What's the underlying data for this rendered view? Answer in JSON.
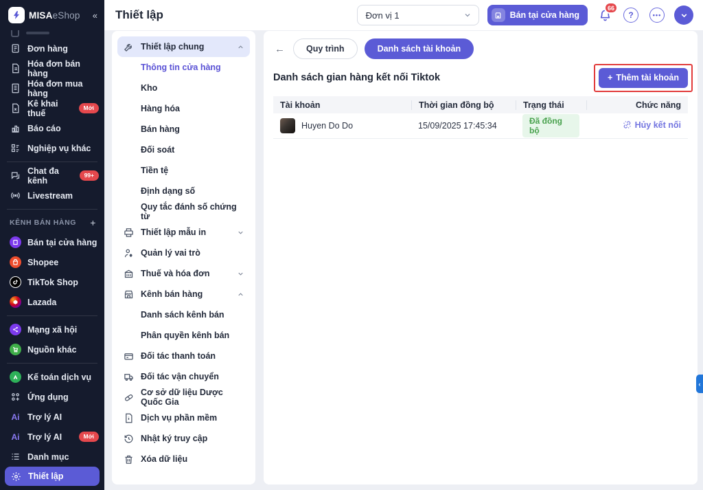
{
  "colors": {
    "accent": "#5b5bd6",
    "sidebar_bg": "#151b2d",
    "annotation_red": "#e23b3b",
    "badge_red": "#e5484d",
    "status_green_bg": "#e7f6ea",
    "status_green_text": "#48a14d",
    "selected_item_bg": "#e3e8fb",
    "edge_tab_blue": "#2176d9"
  },
  "brand": {
    "misa": "MISA",
    "eshop": "eShop"
  },
  "icons": {
    "collapse": "«",
    "back": "←",
    "plus": "+",
    "help": "?",
    "more": "•••",
    "edge_collapse": "‹",
    "ai": "Ai",
    "section_add": "+"
  },
  "topbar": {
    "title": "Thiết lập",
    "unit_select": {
      "value": "Đơn vị 1"
    },
    "store_button": "Bán tại cửa hàng",
    "notification_count": "66"
  },
  "primary_sidebar": {
    "section_label": "KÊNH BÁN HÀNG",
    "items": [
      {
        "label": "Đơn hàng"
      },
      {
        "label": "Hóa đơn bán hàng"
      },
      {
        "label": "Hóa đơn mua hàng"
      },
      {
        "label": "Kê khai thuế",
        "badge": "Mới"
      },
      {
        "label": "Báo cáo"
      },
      {
        "label": "Nghiệp vụ khác"
      },
      {
        "label": "Chat đa kênh",
        "badge": "99+"
      },
      {
        "label": "Livestream"
      },
      {
        "label": "Bán tại cửa hàng"
      },
      {
        "label": "Shopee"
      },
      {
        "label": "TikTok Shop"
      },
      {
        "label": "Lazada"
      },
      {
        "label": "Mạng xã hội"
      },
      {
        "label": "Nguồn khác"
      },
      {
        "label": "Kế toán dịch vụ"
      },
      {
        "label": "Ứng dụng"
      },
      {
        "label": "Trợ lý AI"
      },
      {
        "label": "Trợ lý AI",
        "badge": "Mới"
      },
      {
        "label": "Danh mục"
      },
      {
        "label": "Thiết lập"
      }
    ]
  },
  "settings_sidebar": {
    "items": [
      {
        "label": "Thiết lập chung"
      },
      {
        "label": "Thông tin cửa hàng"
      },
      {
        "label": "Kho"
      },
      {
        "label": "Hàng hóa"
      },
      {
        "label": "Bán hàng"
      },
      {
        "label": "Đối soát"
      },
      {
        "label": "Tiền tệ"
      },
      {
        "label": "Định dạng số"
      },
      {
        "label": "Quy tắc đánh số chứng từ"
      },
      {
        "label": "Thiết lập mẫu in"
      },
      {
        "label": "Quản lý vai trò"
      },
      {
        "label": "Thuế và hóa đơn"
      },
      {
        "label": "Kênh bán hàng"
      },
      {
        "label": "Danh sách kênh bán"
      },
      {
        "label": "Phân quyền kênh bán"
      },
      {
        "label": "Đối tác thanh toán"
      },
      {
        "label": "Đối tác vận chuyển"
      },
      {
        "label": "Cơ sở dữ liệu Dược Quốc Gia"
      },
      {
        "label": "Dịch vụ phần mềm"
      },
      {
        "label": "Nhật ký truy cập"
      },
      {
        "label": "Xóa dữ liệu"
      }
    ]
  },
  "main": {
    "tabs": {
      "tab1": "Quy trình",
      "tab2": "Danh sách tài khoản"
    },
    "title": "Danh sách gian hàng kết nối Tiktok",
    "add_button_label": "Thêm tài khoản",
    "table": {
      "headers": [
        "Tài khoản",
        "Thời gian đồng bộ",
        "Trạng thái",
        "Chức năng"
      ],
      "rows": [
        {
          "account": "Huyen Do Do",
          "sync_time": "15/09/2025 17:45:34",
          "status": "Đã đồng bộ",
          "action": "Hủy kết nối"
        }
      ]
    }
  }
}
